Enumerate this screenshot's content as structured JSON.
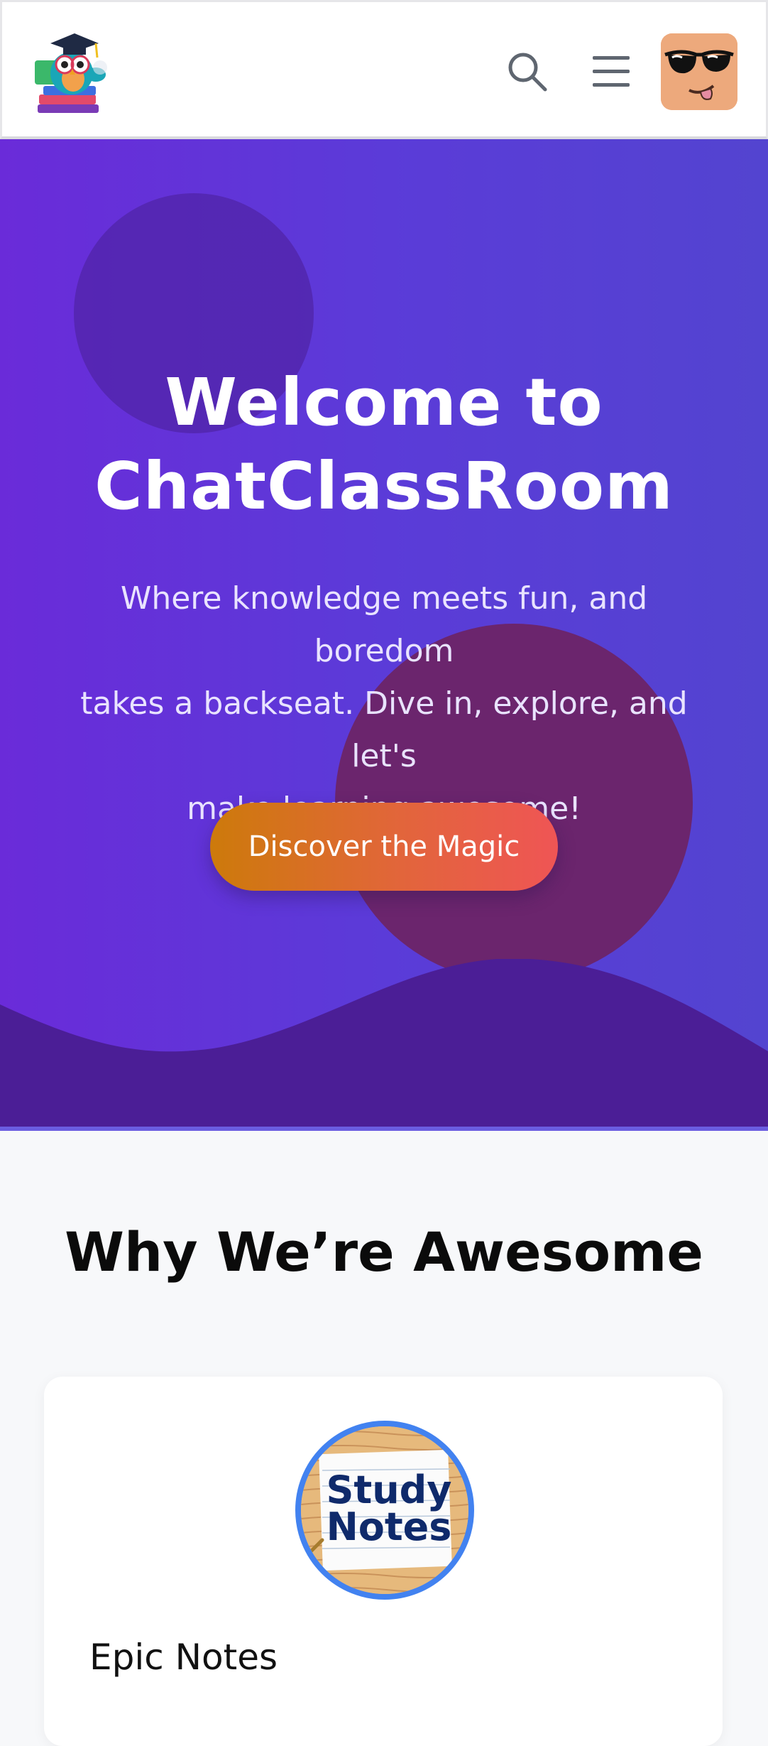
{
  "header": {
    "logo_icon": "owl-graduate-logo",
    "search_icon": "search-icon",
    "menu_icon": "hamburger-menu-icon",
    "avatar_icon": "sunglasses-face-avatar"
  },
  "hero": {
    "title_line1": "Welcome to",
    "title_line2": "ChatClassRoom",
    "subtitle_line1": "Where knowledge meets fun, and boredom",
    "subtitle_line2": "takes a backseat. Dive in, explore, and let's",
    "subtitle_line3": "make learning awesome!",
    "cta_label": "Discover the Magic",
    "colors": {
      "gradient_start": "#6a2bd9",
      "gradient_end": "#5344d0",
      "cta_start": "#cd7a0b",
      "cta_end": "#ef5555"
    }
  },
  "features": {
    "title": "Why We’re Awesome",
    "cards": [
      {
        "icon_text_line1": "Study",
        "icon_text_line2": "Notes",
        "title": "Epic Notes"
      }
    ]
  }
}
